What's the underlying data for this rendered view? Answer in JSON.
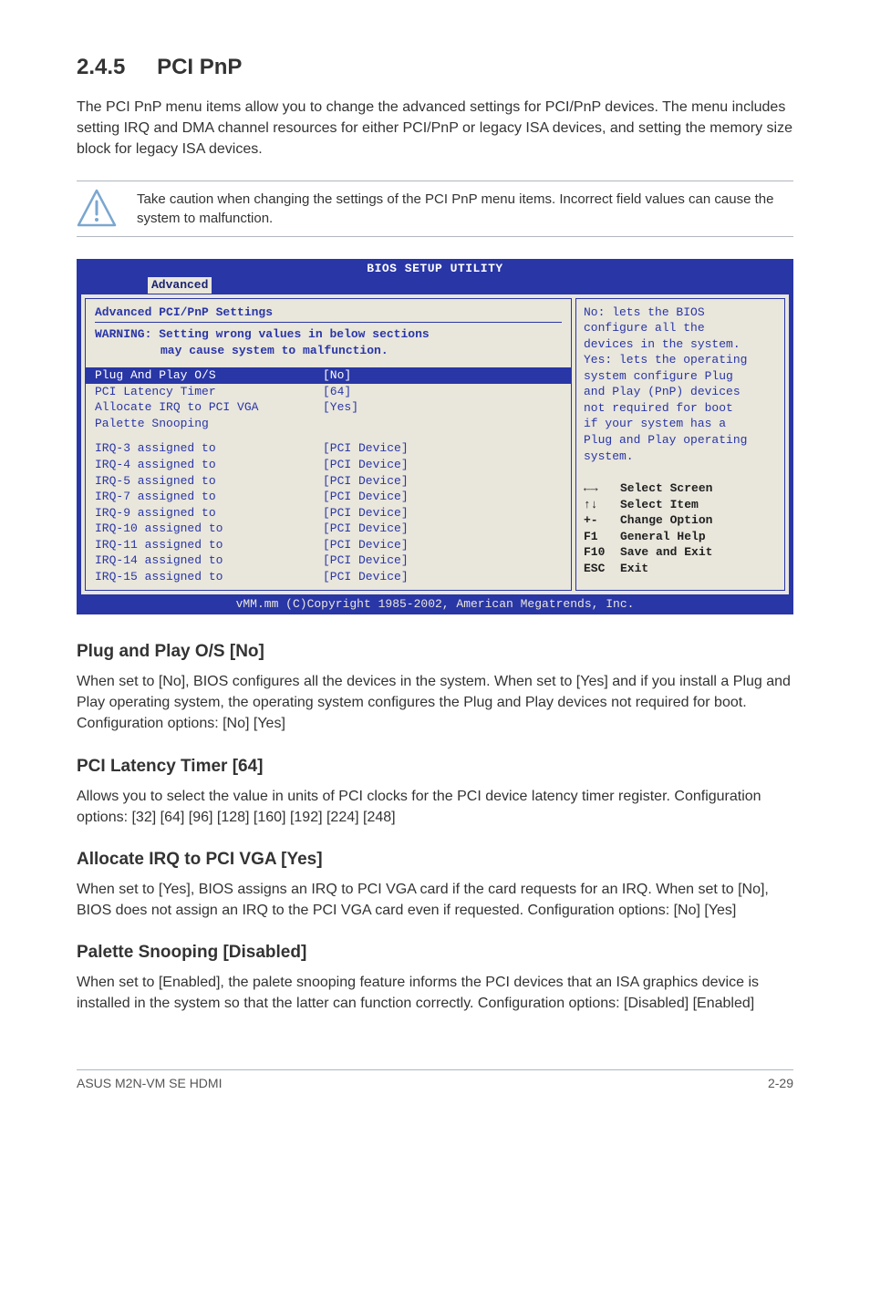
{
  "section": {
    "number": "2.4.5",
    "title": "PCI PnP"
  },
  "intro": "The PCI PnP menu items allow you to change the advanced settings for PCI/PnP devices. The menu includes setting IRQ and DMA channel resources for either PCI/PnP or legacy ISA devices, and setting the memory size block for legacy ISA devices.",
  "caution": "Take caution when changing the settings of the PCI PnP menu items. Incorrect field values can cause the system to malfunction.",
  "bios": {
    "title": "BIOS SETUP UTILITY",
    "tab": "Advanced",
    "header": "Advanced PCI/PnP Settings",
    "warning_label": "WARNING:",
    "warning_line1": "Setting wrong values in below sections",
    "warning_line2": "may cause system to malfunction.",
    "rows": [
      {
        "k": "Plug And Play O/S",
        "v": "[No]",
        "sel": true
      },
      {
        "k": "PCI Latency Timer",
        "v": "[64]"
      },
      {
        "k": "Allocate IRQ to PCI VGA",
        "v": "[Yes]"
      },
      {
        "k": "Palette Snooping",
        "v": ""
      }
    ],
    "irq_rows": [
      {
        "k": "IRQ-3 assigned to",
        "v": "[PCI Device]"
      },
      {
        "k": "IRQ-4 assigned to",
        "v": "[PCI Device]"
      },
      {
        "k": "IRQ-5 assigned to",
        "v": "[PCI Device]"
      },
      {
        "k": "IRQ-7 assigned to",
        "v": "[PCI Device]"
      },
      {
        "k": "IRQ-9 assigned to",
        "v": "[PCI Device]"
      },
      {
        "k": "IRQ-10 assigned to",
        "v": "[PCI Device]"
      },
      {
        "k": "IRQ-11 assigned to",
        "v": "[PCI Device]"
      },
      {
        "k": "IRQ-14 assigned to",
        "v": "[PCI Device]"
      },
      {
        "k": "IRQ-15 assigned to",
        "v": "[PCI Device]"
      }
    ],
    "help": {
      "l1": "No: lets the BIOS",
      "l2": "configure all the",
      "l3": "devices in the system.",
      "l4": "Yes: lets the operating",
      "l5": "system configure Plug",
      "l6": "and Play (PnP) devices",
      "l7": "not required for boot",
      "l8": "if your system has a",
      "l9": "Plug and Play operating",
      "l10": "system."
    },
    "keys": [
      {
        "k": "←→",
        "t": "Select Screen"
      },
      {
        "k": "↑↓",
        "t": "Select Item"
      },
      {
        "k": "+-",
        "t": "Change Option"
      },
      {
        "k": "F1",
        "t": "General Help"
      },
      {
        "k": "F10",
        "t": "Save and Exit"
      },
      {
        "k": "ESC",
        "t": "Exit"
      }
    ],
    "footer": "vMM.mm (C)Copyright 1985-2002, American Megatrends, Inc."
  },
  "options": {
    "o1": {
      "head": "Plug and Play O/S [No]",
      "body": "When set to [No], BIOS configures all the devices in the system. When set to [Yes] and if you install a Plug and Play operating system, the operating system configures the Plug and Play devices not required for boot.\nConfiguration options: [No] [Yes]"
    },
    "o2": {
      "head": "PCI Latency Timer [64]",
      "body": "Allows you to select the value in units of PCI clocks for the PCI device latency timer register. Configuration options: [32] [64] [96] [128] [160] [192] [224] [248]"
    },
    "o3": {
      "head": "Allocate IRQ to PCI VGA [Yes]",
      "body": "When set to [Yes], BIOS assigns an IRQ to PCI VGA card if the card requests for an IRQ. When set to [No], BIOS does not assign an IRQ to the PCI VGA card even if requested. Configuration options: [No] [Yes]"
    },
    "o4": {
      "head": "Palette Snooping [Disabled]",
      "body": "When set to [Enabled], the palete snooping feature informs the PCI devices that an ISA graphics device is installed in the system so that the latter can function correctly. Configuration options: [Disabled] [Enabled]"
    }
  },
  "footer": {
    "left": "ASUS M2N-VM SE HDMI",
    "right": "2-29"
  }
}
